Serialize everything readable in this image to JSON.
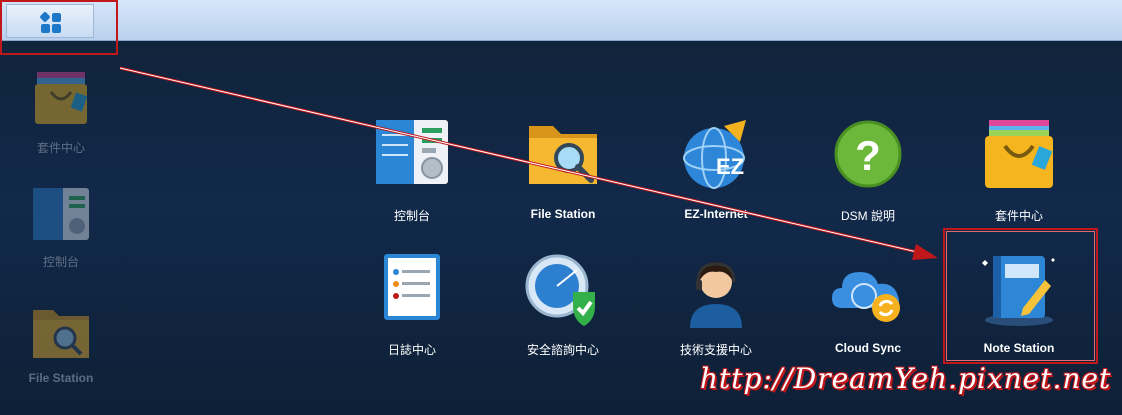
{
  "taskbar": {
    "main_menu_icon": "grid-icon"
  },
  "desktop": {
    "shortcuts": [
      {
        "label": "套件中心",
        "icon": "package-center-icon"
      },
      {
        "label": "控制台",
        "icon": "control-panel-icon"
      },
      {
        "label": "File Station",
        "icon": "file-station-icon"
      }
    ]
  },
  "main_menu": {
    "apps": [
      {
        "label": "控制台",
        "icon": "control-panel-icon"
      },
      {
        "label": "File Station",
        "icon": "file-station-icon"
      },
      {
        "label": "EZ-Internet",
        "icon": "ez-internet-icon"
      },
      {
        "label": "DSM 說明",
        "icon": "help-icon"
      },
      {
        "label": "套件中心",
        "icon": "package-center-icon"
      },
      {
        "label": "日誌中心",
        "icon": "log-center-icon"
      },
      {
        "label": "安全諮詢中心",
        "icon": "security-advisor-icon"
      },
      {
        "label": "技術支援中心",
        "icon": "support-center-icon"
      },
      {
        "label": "Cloud Sync",
        "icon": "cloud-sync-icon"
      },
      {
        "label": "Note Station",
        "icon": "note-station-icon"
      }
    ]
  },
  "watermark": "http://DreamYeh.pixnet.net",
  "colors": {
    "highlight": "#c0171b",
    "taskbar": "#c9dcf3",
    "desktop": "#12294a"
  }
}
